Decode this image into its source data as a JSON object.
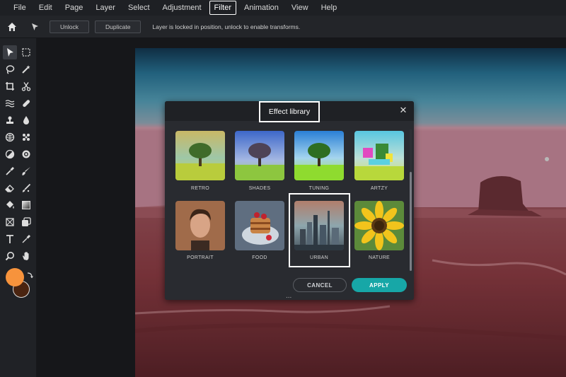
{
  "menubar": {
    "items": [
      "File",
      "Edit",
      "Page",
      "Layer",
      "Select",
      "Adjustment",
      "Filter",
      "Animation",
      "View",
      "Help"
    ],
    "active_index": 6
  },
  "toolbar": {
    "home_icon": "home-icon",
    "pointer_icon": "pointer-icon",
    "unlock_label": "Unlock",
    "duplicate_label": "Duplicate",
    "message": "Layer is locked in position, unlock to enable transforms."
  },
  "tools": {
    "icons": [
      "move-icon",
      "marquee-icon",
      "lasso-icon",
      "magic-wand-icon",
      "crop-icon",
      "scissors-icon",
      "liquify-icon",
      "healing-icon",
      "stamp-icon",
      "blur-drop-icon",
      "sponge-icon",
      "dodge-icon",
      "contrast-icon",
      "sharpen-icon",
      "eyedropper-icon",
      "brush-icon",
      "eraser-icon",
      "replace-color-icon",
      "fill-icon",
      "gradient-icon",
      "shape-icon",
      "color-swap-icon",
      "text-icon",
      "picker-icon",
      "zoom-icon",
      "hand-icon"
    ]
  },
  "colors": {
    "foreground": "#f7933c",
    "background": "#4a2410",
    "accent": "#17a7a7"
  },
  "dialog": {
    "title": "Effect library",
    "close_icon": "close-icon",
    "cancel_label": "CANCEL",
    "apply_label": "APPLY",
    "grip": "...",
    "effects": [
      {
        "label": "RETRO"
      },
      {
        "label": "SHADES"
      },
      {
        "label": "TUNING"
      },
      {
        "label": "ARTZY"
      },
      {
        "label": "PORTRAIT"
      },
      {
        "label": "FOOD"
      },
      {
        "label": "URBAN"
      },
      {
        "label": "NATURE"
      }
    ],
    "selected": "URBAN"
  }
}
